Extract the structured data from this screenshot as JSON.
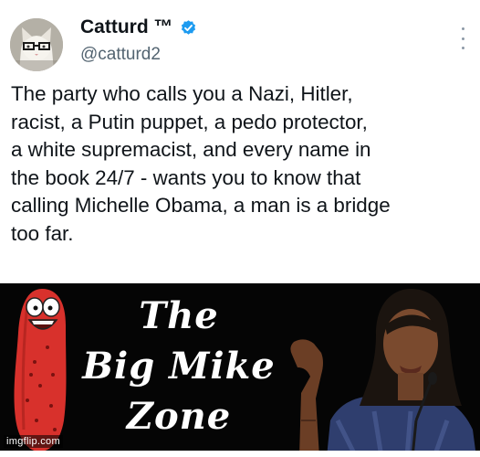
{
  "tweet": {
    "display_name": "Catturd ™",
    "handle": "@catturd2",
    "verified_icon": "verified-badge-icon",
    "more_icon": "vertical-ellipsis-icon",
    "text_lines": [
      "The party who calls you a Nazi, Hitler,",
      "racist, a Putin puppet, a pedo protector,",
      "a white supremacist, and every name in",
      "the book 24/7 - wants you to know that",
      "calling Michelle Obama, a man is a bridge",
      "too far."
    ]
  },
  "banner": {
    "title_lines": [
      "The",
      "Big Mike",
      "Zone"
    ]
  },
  "watermark": "imgflip.com",
  "colors": {
    "verified": "#1d9bf0",
    "handle": "#536471",
    "banner_bg": "#050505",
    "pickle": "#d8312c"
  }
}
